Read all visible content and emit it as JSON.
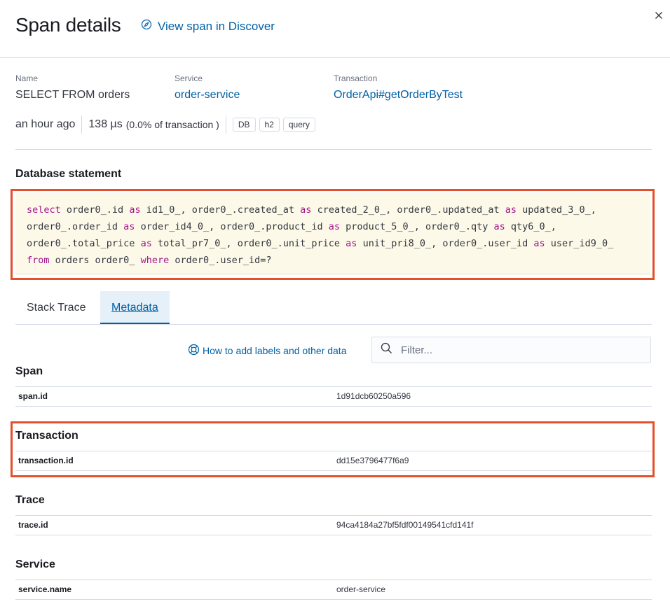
{
  "header": {
    "title": "Span details",
    "discover_link": "View span in Discover"
  },
  "summary": {
    "name_label": "Name",
    "name_value": "SELECT FROM orders",
    "service_label": "Service",
    "service_value": "order-service",
    "transaction_label": "Transaction",
    "transaction_value": "OrderApi#getOrderByTest",
    "time_ago": "an hour ago",
    "duration": "138 µs",
    "percent": "(0.0% of transaction )",
    "badges": [
      "DB",
      "h2",
      "query"
    ]
  },
  "db_statement": {
    "title": "Database statement",
    "lines": [
      [
        [
          "kw",
          "select"
        ],
        [
          "t",
          " order0_.id "
        ],
        [
          "kw",
          "as"
        ],
        [
          "t",
          " id1_0_, order0_.created_at "
        ],
        [
          "kw",
          "as"
        ],
        [
          "t",
          " created_2_0_, order0_.updated_at "
        ],
        [
          "kw",
          "as"
        ],
        [
          "t",
          " updated_3_0_,"
        ]
      ],
      [
        [
          "t",
          "order0_.order_id "
        ],
        [
          "kw",
          "as"
        ],
        [
          "t",
          " order_id4_0_, order0_.product_id "
        ],
        [
          "kw",
          "as"
        ],
        [
          "t",
          " product_5_0_, order0_.qty "
        ],
        [
          "kw",
          "as"
        ],
        [
          "t",
          " qty6_0_,"
        ]
      ],
      [
        [
          "t",
          "order0_.total_price "
        ],
        [
          "kw",
          "as"
        ],
        [
          "t",
          " total_pr7_0_, order0_.unit_price "
        ],
        [
          "kw",
          "as"
        ],
        [
          "t",
          " unit_pri8_0_, order0_.user_id "
        ],
        [
          "kw",
          "as"
        ],
        [
          "t",
          " user_id9_0_"
        ]
      ],
      [
        [
          "kw",
          "from"
        ],
        [
          "t",
          " orders order0_ "
        ],
        [
          "kw",
          "where"
        ],
        [
          "t",
          " order0_.user_id=?"
        ]
      ]
    ]
  },
  "tabs": {
    "stack_trace": "Stack Trace",
    "metadata": "Metadata"
  },
  "metadata": {
    "help_link": "How to add labels and other data",
    "filter_placeholder": "Filter...",
    "sections": {
      "span": {
        "title": "Span",
        "key": "span.id",
        "value": "1d91dcb60250a596"
      },
      "transaction": {
        "title": "Transaction",
        "key": "transaction.id",
        "value": "dd15e3796477f6a9"
      },
      "trace": {
        "title": "Trace",
        "key": "trace.id",
        "value": "94ca4184a27bf5fdf00149541cfd141f"
      },
      "service": {
        "title": "Service",
        "key": "service.name",
        "value": "order-service"
      }
    }
  },
  "colors": {
    "link": "#0061a6",
    "keyword": "#a2138d",
    "highlight": "#e4502a",
    "code_bg": "#fdf9e8"
  }
}
